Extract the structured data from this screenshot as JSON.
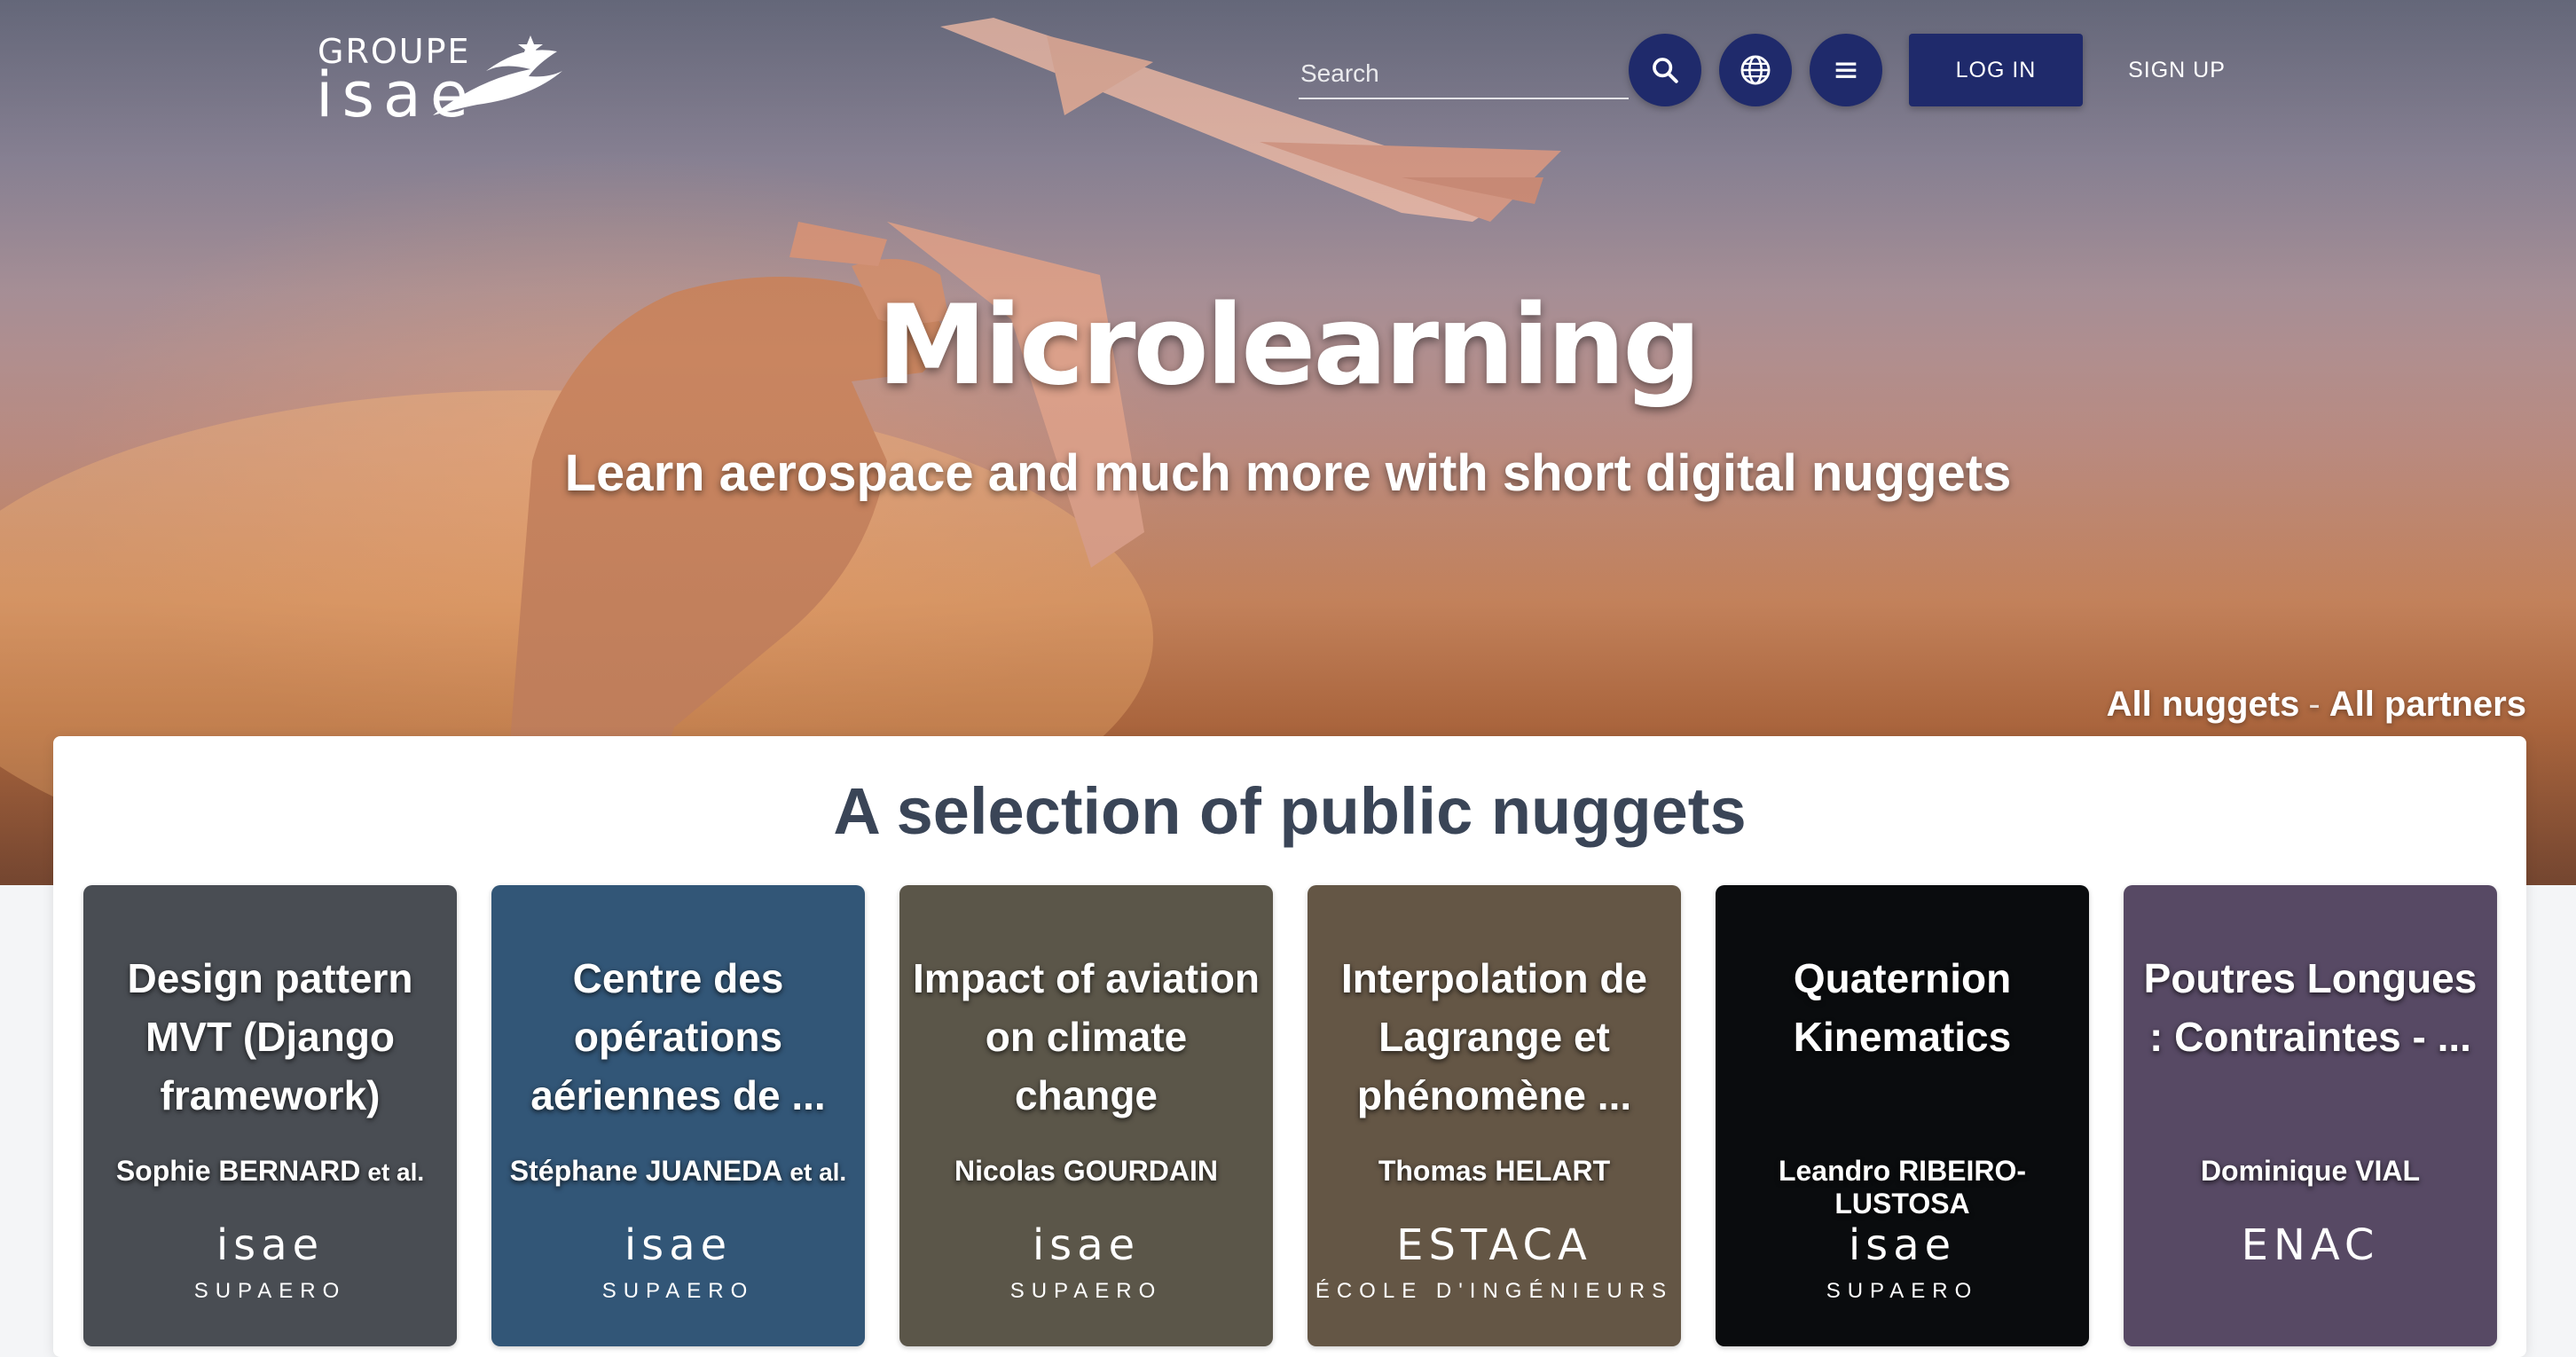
{
  "header": {
    "logo": {
      "line1": "GROUPE",
      "line2": "isae"
    },
    "search": {
      "placeholder": "Search"
    },
    "login_label": "LOG IN",
    "signup_label": "SIGN UP"
  },
  "hero": {
    "title": "Microlearning",
    "subtitle": "Learn aerospace and much more with short digital nuggets",
    "links": {
      "all_nuggets": "All nuggets",
      "separator": "-",
      "all_partners": "All partners"
    }
  },
  "section": {
    "title": "A selection of public nuggets"
  },
  "cards": [
    {
      "title": "Design pattern MVT (Django framework)",
      "author": "Sophie BERNARD",
      "author_suffix": "et al.",
      "partner": "isae",
      "partner_sub": "SUPAERO",
      "bg": "#5a5e66"
    },
    {
      "title": "Centre des opérations aériennes de ...",
      "author": "Stéphane JUANEDA",
      "author_suffix": "et al.",
      "partner": "isae",
      "partner_sub": "SUPAERO",
      "bg": "#3d6a92"
    },
    {
      "title": "Impact of aviation on climate change",
      "author": "Nicolas GOURDAIN",
      "author_suffix": "",
      "partner": "isae",
      "partner_sub": "SUPAERO",
      "bg": "#6f6a5a"
    },
    {
      "title": "Interpolation de Lagrange et phénomène ...",
      "author": "Thomas HELART",
      "author_suffix": "",
      "partner": "ESTACA",
      "partner_sub": "ÉCOLE D'INGÉNIEURS",
      "bg": "#7b6a55"
    },
    {
      "title": "Quaternion Kinematics",
      "author": "Leandro RIBEIRO-LUSTOSA",
      "author_suffix": "",
      "partner": "isae",
      "partner_sub": "SUPAERO",
      "bg": "#0d0f12"
    },
    {
      "title": "Poutres Longues : Contraintes - ...",
      "author": "Dominique VIAL",
      "author_suffix": "",
      "partner": "ENAC",
      "partner_sub": "",
      "bg": "#6b5a7a"
    }
  ]
}
